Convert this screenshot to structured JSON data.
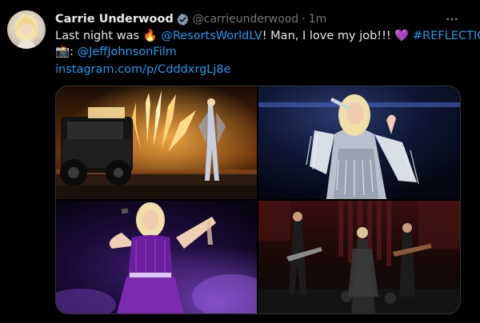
{
  "tweet": {
    "display_name": "Carrie Underwood",
    "handle": "@carrieunderwood",
    "separator": "·",
    "time": "1m",
    "more_icon": "more-horizontal-icon",
    "line1": {
      "prefix": "Last night was",
      "fire_emoji": "🔥",
      "mention": "@ResortsWorldLV",
      "middle": "! Man, I love my job!!!",
      "heart_emoji": "💜",
      "hashtag": "#REFLECTION"
    },
    "line2": {
      "camera_emoji": "📸",
      "colon": ":",
      "mention": "@JeffJohnsonFilm"
    },
    "line3": {
      "link": "instagram.com/p/CdddxrgLj8e"
    }
  },
  "colors": {
    "background": "#000000",
    "text": "#e7e9ea",
    "secondary": "#71767b",
    "link": "#1d9bf0",
    "verified": "#829aab",
    "border": "#2f3336"
  },
  "media": {
    "photos": [
      {
        "name": "photo-stage-jeep-fireworks"
      },
      {
        "name": "photo-singer-silver-fringe"
      },
      {
        "name": "photo-singer-purple-dress"
      },
      {
        "name": "photo-band-on-stage"
      }
    ]
  }
}
